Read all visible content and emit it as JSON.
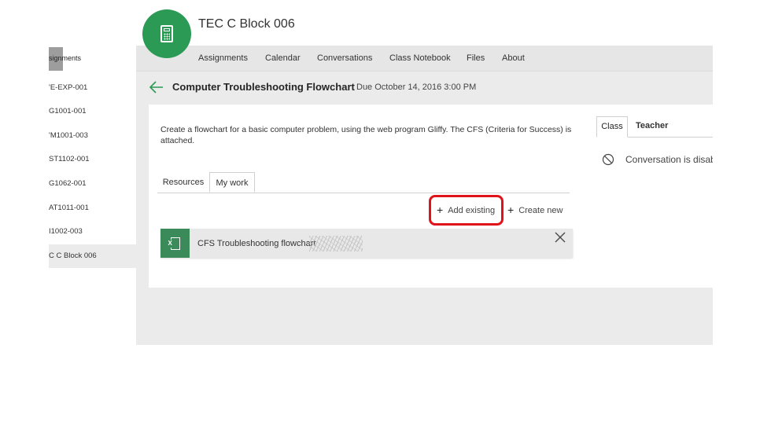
{
  "sidebar": {
    "header": "signments",
    "items": [
      {
        "label": "'E-EXP-001"
      },
      {
        "label": "G1001-001"
      },
      {
        "label": "'M1001-003"
      },
      {
        "label": "ST1102-001"
      },
      {
        "label": "G1062-001"
      },
      {
        "label": "AT1011-001"
      },
      {
        "label": "I1002-003"
      },
      {
        "label": "C C Block 006",
        "active": true
      }
    ]
  },
  "class": {
    "title": "TEC C Block 006",
    "icon": "calculator-icon",
    "accent_color": "#2a9a55"
  },
  "nav": {
    "items": [
      "Assignments",
      "Calendar",
      "Conversations",
      "Class Notebook",
      "Files",
      "About"
    ]
  },
  "assignment": {
    "title": "Computer Troubleshooting Flowchart",
    "due": "Due October 14, 2016 3:00 PM",
    "description": "Create a flowchart for a basic computer problem, using the web program Gliffy. The CFS (Criteria for Success) is attached."
  },
  "tabs": {
    "resources": "Resources",
    "my_work": "My work",
    "active": "My work"
  },
  "actions": {
    "add_existing": "Add existing",
    "create_new": "Create new",
    "highlight_color": "#e0121a"
  },
  "file": {
    "name": "CFS Troubleshooting flowchart",
    "type_icon": "excel-icon",
    "type_letter": "X",
    "icon_color": "#3b8a5a"
  },
  "right_panel": {
    "tab_class": "Class",
    "tab_teacher": "Teacher",
    "message": "Conversation is disab"
  }
}
